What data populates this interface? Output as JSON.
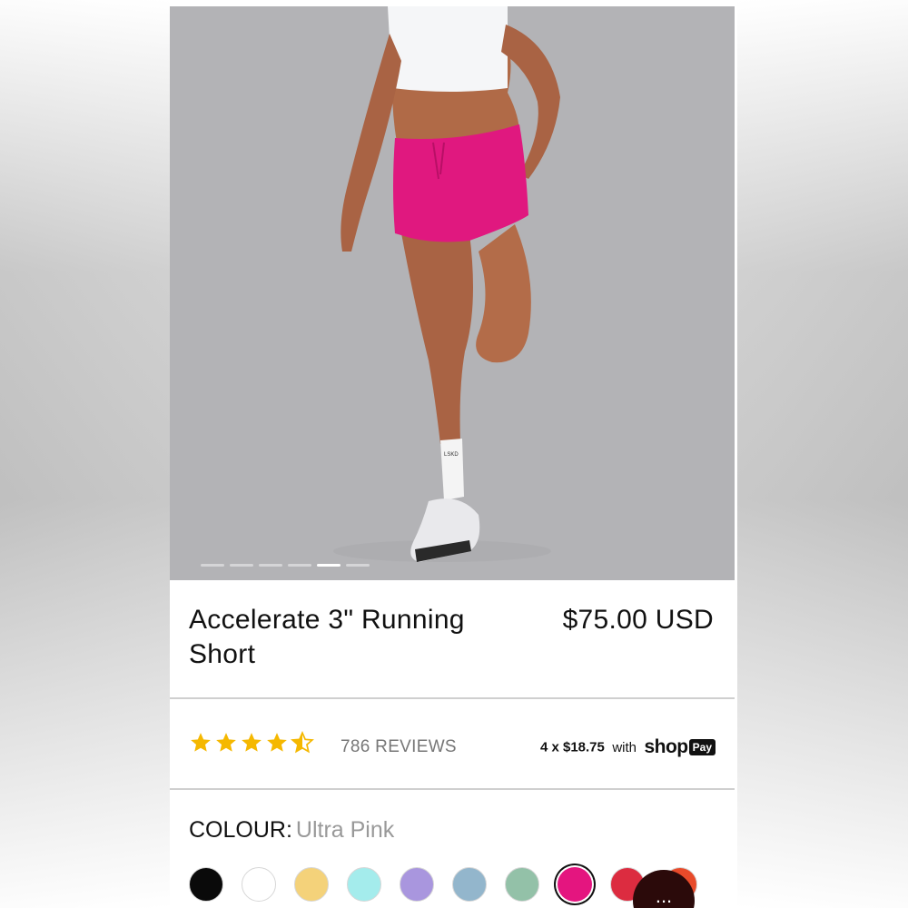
{
  "product": {
    "title": "Accelerate 3\" Running Short",
    "price": "$75.00 USD",
    "image_alt": "Model running in pink shorts",
    "sock_logo": "LSKD"
  },
  "carousel": {
    "total": 6,
    "active_index": 4
  },
  "rating": {
    "score": 4.5,
    "max": 5,
    "reviews_label": "786 REVIEWS",
    "star_color": "#f5b800"
  },
  "payment": {
    "installment": "4 x $18.75",
    "with": "with",
    "brand_shop": "shop",
    "brand_pay": "Pay"
  },
  "colour": {
    "label": "COLOUR:",
    "selected_name": "Ultra Pink",
    "swatches": [
      {
        "name": "Black",
        "color": "#0a0a0a"
      },
      {
        "name": "White",
        "color": "#ffffff"
      },
      {
        "name": "Yellow",
        "color": "#f4d27a"
      },
      {
        "name": "Aqua",
        "color": "#a4ecec"
      },
      {
        "name": "Lavender",
        "color": "#a996de"
      },
      {
        "name": "Blue Grey",
        "color": "#93b6cc"
      },
      {
        "name": "Sage",
        "color": "#93c1a8"
      },
      {
        "name": "Ultra Pink",
        "color": "#e4157f",
        "selected": true
      },
      {
        "name": "Red",
        "color": "#dc2c40"
      },
      {
        "name": "Orange",
        "color": "#e84a2a"
      }
    ]
  },
  "chat": {
    "label": "..."
  }
}
